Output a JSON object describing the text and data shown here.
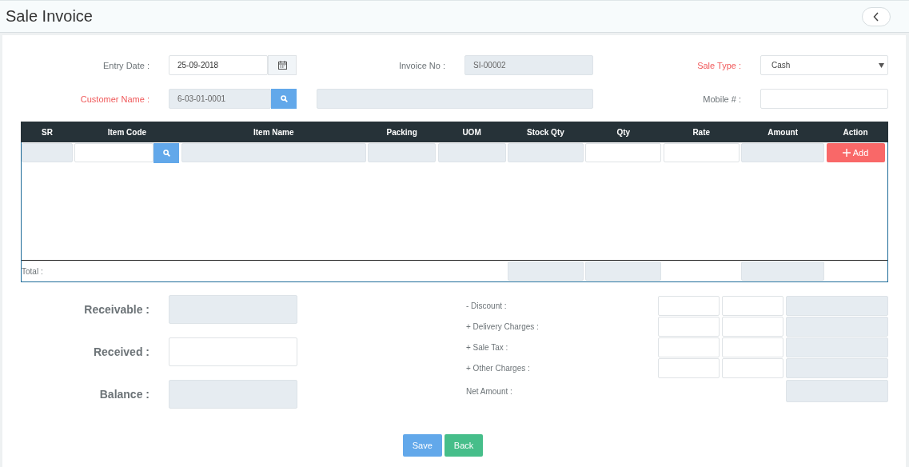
{
  "header": {
    "title": "Sale Invoice"
  },
  "fields": [
    {
      "kind": "date",
      "label": "Entry Date :",
      "required": false,
      "disabled": false,
      "value": "25-09-2018"
    },
    {
      "kind": "text",
      "label": "Invoice No :",
      "required": false,
      "disabled": true,
      "value": "SI-00002"
    },
    {
      "kind": "select",
      "label": "Sale Type :",
      "required": true,
      "disabled": false,
      "value": "Cash"
    },
    {
      "kind": "lookup",
      "label": "Customer Name :",
      "required": true,
      "disabled": true,
      "value": "6-03-01-0001"
    },
    {
      "kind": "wide",
      "disabled": true
    },
    {
      "kind": "text",
      "label": "Mobile # :",
      "required": false,
      "disabled": false
    }
  ],
  "table": {
    "columns": [
      "SR",
      "Item Code",
      "Item Name",
      "Packing",
      "UOM",
      "Stock Qty",
      "Qty",
      "Rate",
      "Amount",
      "Action"
    ],
    "row": [
      {
        "kind": "field",
        "disabled": true
      },
      {
        "kind": "lookup",
        "disabled": false
      },
      {
        "kind": "field",
        "disabled": true
      },
      {
        "kind": "field",
        "disabled": true
      },
      {
        "kind": "field",
        "disabled": true
      },
      {
        "kind": "field",
        "disabled": true
      },
      {
        "kind": "field",
        "disabled": false
      },
      {
        "kind": "field",
        "disabled": false
      },
      {
        "kind": "field",
        "disabled": true
      },
      {
        "kind": "button",
        "label": "Add"
      }
    ],
    "total": [
      {
        "kind": "label",
        "text": "Total :"
      },
      {
        "kind": "empty"
      },
      {
        "kind": "empty"
      },
      {
        "kind": "empty"
      },
      {
        "kind": "empty"
      },
      {
        "kind": "field"
      },
      {
        "kind": "field"
      },
      {
        "kind": "empty"
      },
      {
        "kind": "field"
      },
      {
        "kind": "empty"
      }
    ]
  },
  "balance": [
    {
      "label": "Receivable :",
      "disabled": true
    },
    {
      "label": "Received :",
      "disabled": false
    },
    {
      "label": "Balance :",
      "disabled": true
    }
  ],
  "charges": [
    {
      "label": "- Discount :",
      "fields": [
        {
          "disabled": false
        },
        {
          "disabled": false
        },
        {
          "disabled": true
        }
      ]
    },
    {
      "label": "+ Delivery Charges :",
      "fields": [
        {
          "disabled": false
        },
        {
          "disabled": false
        },
        {
          "disabled": true
        }
      ]
    },
    {
      "label": "+ Sale Tax :",
      "fields": [
        {
          "disabled": false
        },
        {
          "disabled": false
        },
        {
          "disabled": true
        }
      ]
    },
    {
      "label": "+ Other Charges :",
      "fields": [
        {
          "disabled": false
        },
        {
          "disabled": false
        },
        {
          "disabled": true
        }
      ]
    },
    {
      "label": "Net Amount :",
      "fields": [
        {
          "disabled": true
        }
      ]
    }
  ],
  "buttons": [
    {
      "label": "Save",
      "kind": "primary"
    },
    {
      "label": "Back",
      "kind": "success"
    }
  ]
}
